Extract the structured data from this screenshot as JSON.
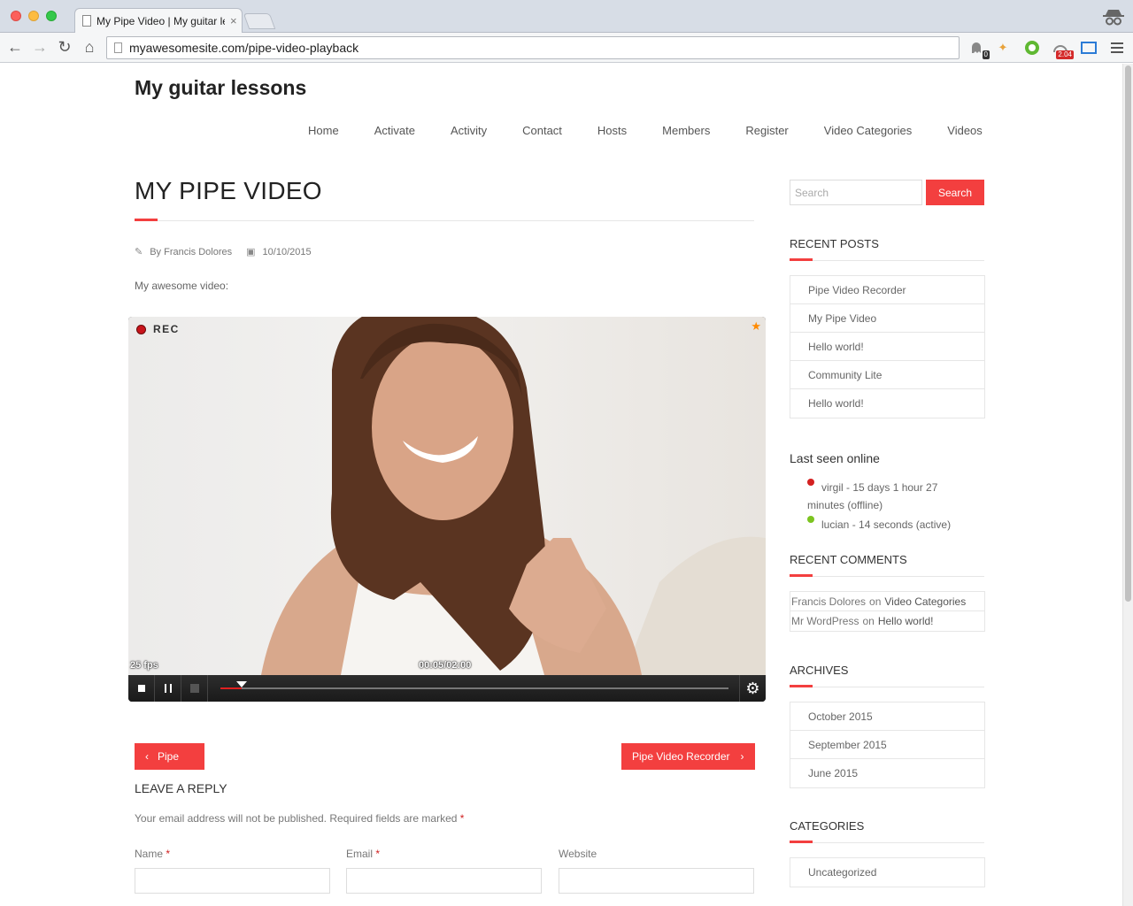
{
  "browser": {
    "tab_title": "My Pipe Video | My guitar lessons",
    "tab_close": "×",
    "url": "myawesomesite.com/pipe-video-playback",
    "ext_badge_count": "0",
    "ext_badge_value": "2.04"
  },
  "site": {
    "title": "My guitar lessons",
    "nav": [
      "Home",
      "Activate",
      "Activity",
      "Contact",
      "Hosts",
      "Members",
      "Register",
      "Video Categories",
      "Videos"
    ]
  },
  "post": {
    "title": "MY PIPE VIDEO",
    "author": "By Francis Dolores",
    "date": "10/10/2015",
    "intro": "My awesome video:"
  },
  "player": {
    "rec_label": "REC",
    "fps": "25 fps",
    "timecode": "00:05/02:00",
    "progress": 0.042
  },
  "post_nav": {
    "prev": "Pipe",
    "next": "Pipe Video Recorder"
  },
  "reply": {
    "title": "LEAVE A REPLY",
    "note": "Your email address will not be published. Required fields are marked",
    "required_mark": "*",
    "fields": [
      "Name",
      "Email",
      "Website"
    ]
  },
  "sidebar": {
    "search_placeholder": "Search",
    "search_button": "Search",
    "recent_posts_title": "RECENT POSTS",
    "recent_posts": [
      "Pipe Video Recorder",
      "My Pipe Video",
      "Hello world!",
      "Community Lite",
      "Hello world!"
    ],
    "last_seen_title": "Last seen online",
    "last_seen": [
      {
        "text": "virgil - 15 days 1 hour 27 minutes (offline)",
        "color": "#d42020"
      },
      {
        "text": "lucian - 14 seconds (active)",
        "color": "#7cc420"
      }
    ],
    "recent_comments_title": "RECENT COMMENTS",
    "recent_comments": [
      {
        "author": "Francis Dolores",
        "on": "on",
        "post": "Video Categories"
      },
      {
        "author": "Mr WordPress",
        "on": "on",
        "post": "Hello world!"
      }
    ],
    "archives_title": "ARCHIVES",
    "archives": [
      "October 2015",
      "September 2015",
      "June 2015"
    ],
    "categories_title": "CATEGORIES",
    "categories": [
      "Uncategorized"
    ]
  },
  "colors": {
    "accent": "#f33f3f"
  }
}
